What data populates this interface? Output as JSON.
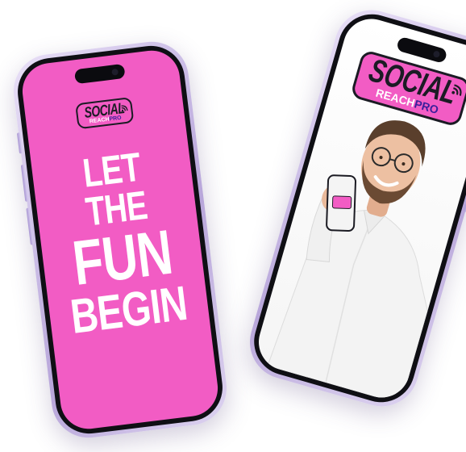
{
  "brand": {
    "logo_main": "SOCIAL",
    "logo_reach": "REACH",
    "logo_pro": "PRO",
    "colors": {
      "pink": "#f25cc4",
      "dark": "#1b1b24",
      "purple": "#3a1f9c",
      "frame": "#cbbde6"
    }
  },
  "left_phone": {
    "headline": [
      "LET THE",
      "FUN",
      "BEGIN"
    ]
  },
  "icons": {
    "signal": "wifi-signal-icon",
    "camera": "camera-island-icon"
  }
}
